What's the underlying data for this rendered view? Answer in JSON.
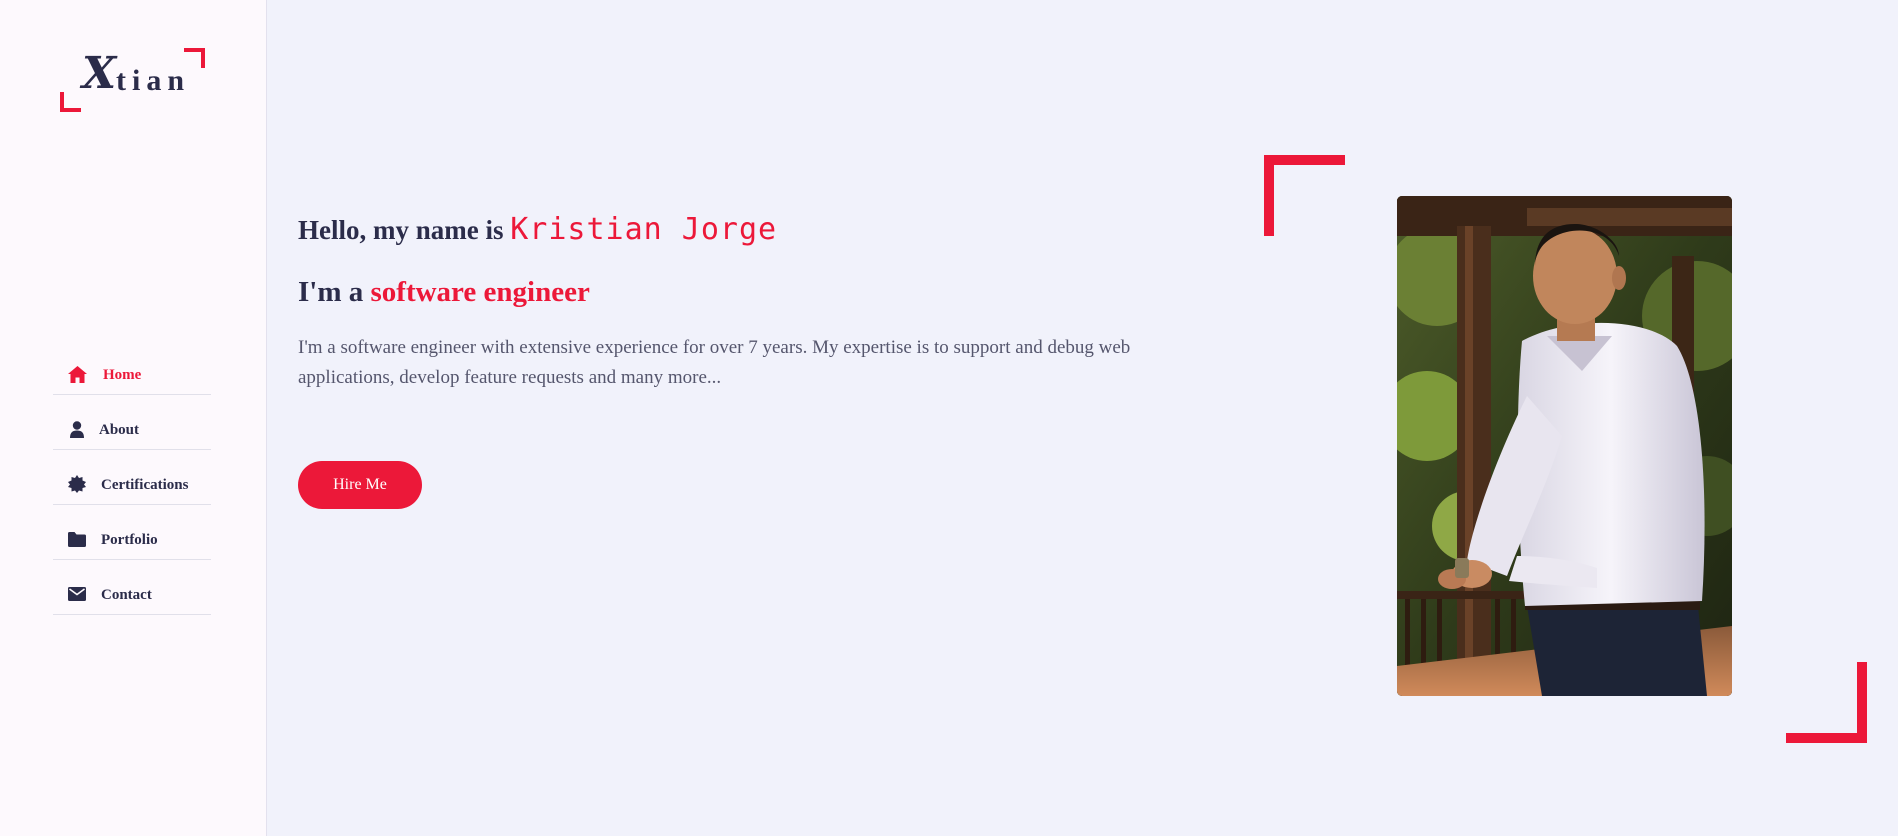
{
  "logo": {
    "first_letter": "X",
    "rest": "tian"
  },
  "nav": {
    "items": [
      {
        "label": "Home",
        "icon": "home-icon",
        "active": true
      },
      {
        "label": "About",
        "icon": "user-icon",
        "active": false
      },
      {
        "label": "Certifications",
        "icon": "certificate-icon",
        "active": false
      },
      {
        "label": "Portfolio",
        "icon": "folder-icon",
        "active": false
      },
      {
        "label": "Contact",
        "icon": "envelope-icon",
        "active": false
      }
    ]
  },
  "hero": {
    "greeting": "Hello, my name is",
    "name": "Kristian Jorge",
    "role_prefix": "I'm a",
    "role": "software engineer",
    "intro": "I'm a software engineer with extensive experience for over 7 years. My expertise is to support and debug web applications, develop feature requests and many more...",
    "cta_label": "Hire Me"
  },
  "colors": {
    "accent": "#ec1839",
    "text_dark": "#2b2c4a",
    "text_muted": "#55566d",
    "page_bg": "#f1f2fb",
    "sidebar_bg": "#fdf9fd"
  }
}
